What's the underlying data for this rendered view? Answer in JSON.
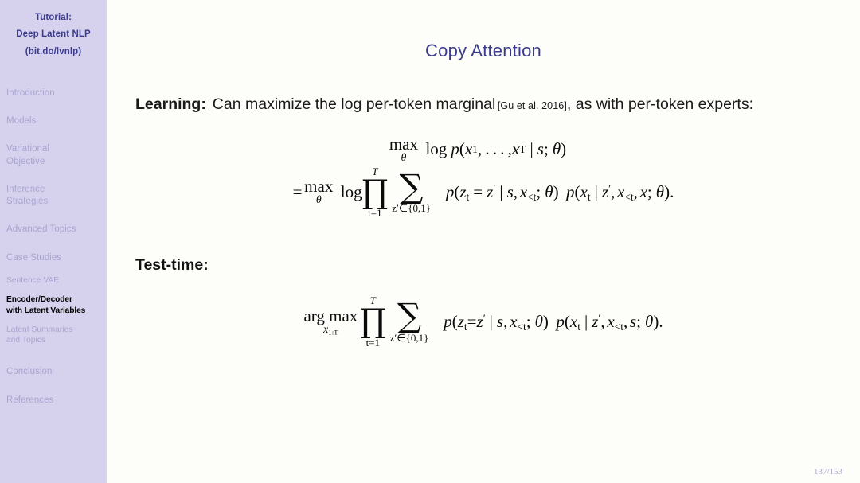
{
  "sidebar": {
    "title_lines": [
      "Tutorial:",
      "Deep Latent NLP",
      "(bit.do/lvnlp)"
    ],
    "items": [
      {
        "label": "Introduction",
        "level": "top",
        "active": false
      },
      {
        "label": "Models",
        "level": "top",
        "active": false
      },
      {
        "label": "Variational Objective",
        "level": "top",
        "active": false
      },
      {
        "label": "Inference Strategies",
        "level": "top",
        "active": false
      },
      {
        "label": "Advanced Topics",
        "level": "top",
        "active": false
      },
      {
        "label": "Case Studies",
        "level": "top",
        "active": false
      },
      {
        "label": "Sentence VAE",
        "level": "sub",
        "active": false
      },
      {
        "label": "Encoder/Decoder with Latent Variables",
        "level": "sub",
        "active": true
      },
      {
        "label": "Latent Summaries and Topics",
        "level": "sub",
        "active": false
      },
      {
        "label": "Conclusion",
        "level": "top",
        "active": false
      },
      {
        "label": "References",
        "level": "top",
        "active": false
      }
    ],
    "item_labels": {
      "introduction": "Introduction",
      "models": "Models",
      "variational_1": "Variational",
      "variational_2": "Objective",
      "inference_1": "Inference",
      "inference_2": "Strategies",
      "advanced": "Advanced Topics",
      "case_studies": "Case Studies",
      "sentence_vae": "Sentence VAE",
      "encoder_decoder_1": "Encoder/Decoder",
      "encoder_decoder_2": "with Latent Variables",
      "latent_summaries_1": "Latent Summaries",
      "latent_summaries_2": "and Topics",
      "conclusion": "Conclusion",
      "references": "References"
    }
  },
  "slide": {
    "title": "Copy Attention",
    "page_number": "137/153"
  },
  "body": {
    "learning_label": "Learning:",
    "learning_text_1": "Can maximize the log per-token marginal",
    "citation": "[Gu et al. 2016]",
    "learning_text_2": ", as with per-token experts:",
    "test_time_label": "Test-time:"
  },
  "math": {
    "eq1_line1": {
      "max": "max",
      "max_sub": "θ",
      "log": "log",
      "p": "p",
      "open": "(",
      "x1": "x",
      "x1_sub": "1",
      "dots": ", . . . ,",
      "xT": "x",
      "xT_sub": "T",
      "bar": "|",
      "s": "s",
      "semi": ";",
      "theta": "θ",
      "close": ")",
      "plain": "max_θ log p(x_1, …, x_T | s; θ)"
    },
    "eq1_line2": {
      "equals": "=",
      "max": "max",
      "max_sub": "θ",
      "log": "log",
      "prod": "∏",
      "prod_over": "T",
      "prod_under": "t=1",
      "sum": "∑",
      "sum_under": "z′∈{0,1}",
      "term1": "p(z_t = z′ | s, x_{<t}; θ)",
      "term2": "p(x_t | z′, x_{<t}, x; θ).",
      "p": "p",
      "z": "z",
      "z_sub": "t",
      "eq": "=",
      "zprime": "z",
      "prime": "′",
      "bar": "|",
      "s": "s",
      "comma": ",",
      "x": "x",
      "x_sub": "<t",
      "semi": ";",
      "theta": "θ",
      "xt": "x",
      "xt_sub": "t",
      "x_last": "x",
      "period": ".",
      "plain": "= max_θ log ∏_{t=1}^{T} ∑_{z′∈{0,1}} p(z_t = z′ | s, x_{<t}; θ) p(x_t | z′, x_{<t}, x; θ)."
    },
    "eq2": {
      "argmax": "arg max",
      "argmax_sub": "x",
      "argmax_sub_rest": "1:T",
      "prod": "∏",
      "prod_over": "T",
      "prod_under": "t=1",
      "sum": "∑",
      "sum_under": "z′∈{0,1}",
      "plain": "arg max_{x_{1:T}} ∏_{t=1}^{T} ∑_{z′∈{0,1}} p(z_t=z′ | s, x_{<t}; θ) p(x_t | z′, x_{<t}, s; θ)."
    },
    "symbols": {
      "prod": "∏",
      "sum": "∑",
      "theta": "θ",
      "prime": "′",
      "in": "∈",
      "mid": "|",
      "lbrace": "{",
      "rbrace": "}"
    }
  },
  "colors": {
    "sidebar_bg": "#d6d2ee",
    "sidebar_text": "#a9a5cf",
    "sidebar_title": "#3b3b8f",
    "title": "#3b3b8f",
    "content_bg": "#fdfdfa",
    "body_text": "#1a1a1a",
    "active_item": "#000000"
  }
}
